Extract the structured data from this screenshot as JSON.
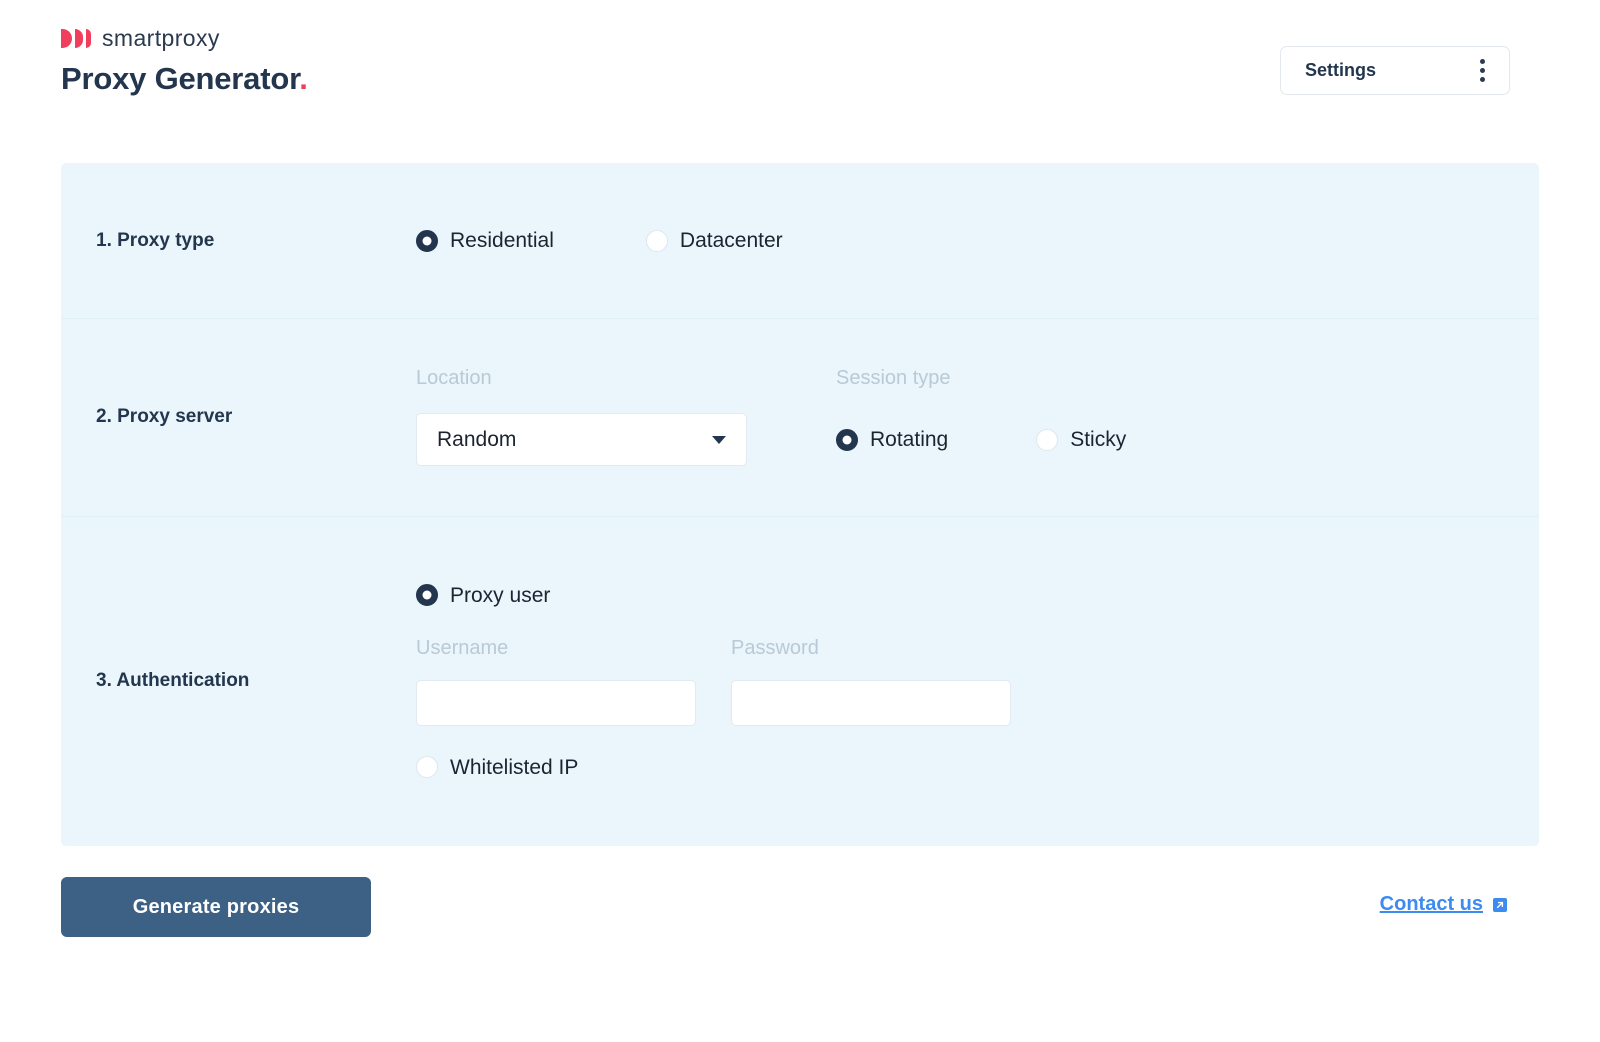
{
  "header": {
    "brand_name": "smartproxy",
    "logo_icon": "smartproxy-bars-icon",
    "title": "Proxy Generator",
    "title_dot": ".",
    "settings_label": "Settings",
    "kebab_icon": "more-vertical-icon"
  },
  "sections": {
    "proxy_type": {
      "label": "1. Proxy type",
      "options": [
        {
          "label": "Residential",
          "selected": true
        },
        {
          "label": "Datacenter",
          "selected": false
        }
      ]
    },
    "proxy_server": {
      "label": "2. Proxy server",
      "location": {
        "field_label": "Location",
        "value": "Random",
        "caret_icon": "chevron-down-icon"
      },
      "session_type": {
        "field_label": "Session type",
        "options": [
          {
            "label": "Rotating",
            "selected": true
          },
          {
            "label": "Sticky",
            "selected": false
          }
        ]
      }
    },
    "authentication": {
      "label": "3. Authentication",
      "proxy_user": {
        "label": "Proxy user",
        "selected": true
      },
      "username": {
        "field_label": "Username",
        "value": "",
        "placeholder": ""
      },
      "password": {
        "field_label": "Password",
        "value": "",
        "placeholder": ""
      },
      "whitelisted_ip": {
        "label": "Whitelisted IP",
        "selected": false
      }
    }
  },
  "footer": {
    "generate_label": "Generate proxies",
    "contact_label": "Contact us",
    "contact_icon": "external-link-icon"
  },
  "colors": {
    "brand_red": "#ef3f5c",
    "navy": "#23364d",
    "panel_bg": "#eaf6fc",
    "button_bg": "#3d6184",
    "link_blue": "#3b8bf0",
    "muted_label": "#b9c9d6"
  }
}
